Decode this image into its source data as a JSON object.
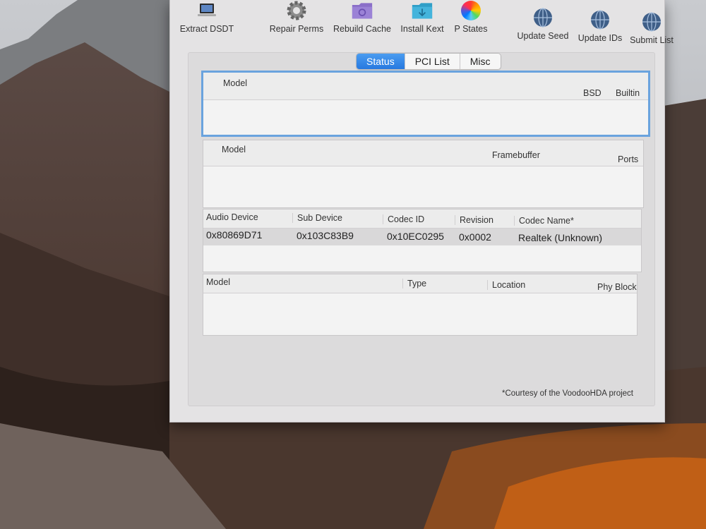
{
  "toolbar": {
    "items": [
      {
        "label": "Extract DSDT",
        "icon": "laptop-icon"
      },
      {
        "label": "Repair Perms",
        "icon": "gear-icon"
      },
      {
        "label": "Rebuild Cache",
        "icon": "folder-icon"
      },
      {
        "label": "Install Kext",
        "icon": "download-folder-icon"
      },
      {
        "label": "P States",
        "icon": "color-wheel-icon"
      },
      {
        "label": "Update Seed",
        "icon": "globe-icon"
      },
      {
        "label": "Update IDs",
        "icon": "globe-icon"
      },
      {
        "label": "Submit List",
        "icon": "globe-icon"
      }
    ]
  },
  "tabs": {
    "items": [
      "Status",
      "PCI List",
      "Misc"
    ],
    "selected": "Status"
  },
  "graphics_table": {
    "headers": {
      "model": "Model",
      "bsd": "BSD",
      "builtin": "Builtin"
    }
  },
  "display_table": {
    "headers": {
      "model": "Model",
      "framebuffer": "Framebuffer",
      "ports": "Ports"
    }
  },
  "audio_table": {
    "headers": {
      "audio_device": "Audio Device",
      "sub_device": "Sub Device",
      "codec_id": "Codec ID",
      "revision": "Revision",
      "codec_name": "Codec Name*"
    },
    "rows": [
      {
        "audio_device": "0x80869D71",
        "sub_device": "0x103C83B9",
        "codec_id": "0x10EC0295",
        "revision": "0x0002",
        "codec_name": "Realtek (Unknown)"
      }
    ]
  },
  "storage_table": {
    "headers": {
      "model": "Model",
      "type": "Type",
      "location": "Location",
      "phy_block": "Phy Block"
    }
  },
  "footnote": "*Courtesy of the VoodooHDA project",
  "colors": {
    "accent": "#2779e0",
    "focus_ring": "#6aa3de",
    "window_bg": "#e4e3e4"
  }
}
